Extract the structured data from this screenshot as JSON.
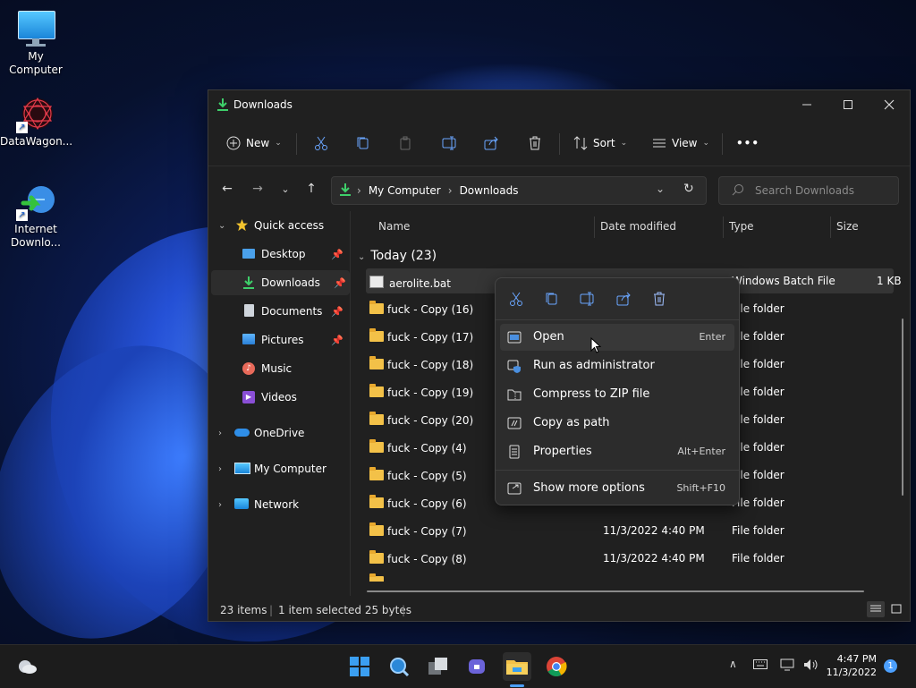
{
  "desktop": {
    "icons": [
      {
        "label": "My Computer"
      },
      {
        "label": "DataWagon..."
      },
      {
        "label": "Internet Downlo..."
      }
    ]
  },
  "window": {
    "title": "Downloads",
    "toolbar": {
      "new_label": "New",
      "sort_label": "Sort",
      "view_label": "View",
      "more_label": "•••"
    },
    "address": {
      "crumbs": [
        "My Computer",
        "Downloads"
      ]
    },
    "search": {
      "placeholder": "Search Downloads"
    }
  },
  "sidebar": {
    "quick_access": "Quick access",
    "items": [
      {
        "label": "Desktop",
        "pinned": true
      },
      {
        "label": "Downloads",
        "pinned": true,
        "selected": true
      },
      {
        "label": "Documents",
        "pinned": true
      },
      {
        "label": "Pictures",
        "pinned": true
      },
      {
        "label": "Music",
        "pinned": false
      },
      {
        "label": "Videos",
        "pinned": false
      }
    ],
    "onedrive": "OneDrive",
    "my_computer": "My Computer",
    "network": "Network"
  },
  "columns": {
    "name": "Name",
    "date": "Date modified",
    "type": "Type",
    "size": "Size"
  },
  "group": {
    "label": "Today (23)"
  },
  "files": [
    {
      "name": "aerolite.bat",
      "date": "",
      "type": "Windows Batch File",
      "size": "1 KB",
      "kind": "bat",
      "selected": true
    },
    {
      "name": "fuck - Copy (16)",
      "date": "",
      "type": "File folder",
      "size": "",
      "kind": "folder"
    },
    {
      "name": "fuck - Copy (17)",
      "date": "",
      "type": "File folder",
      "size": "",
      "kind": "folder"
    },
    {
      "name": "fuck - Copy (18)",
      "date": "",
      "type": "File folder",
      "size": "",
      "kind": "folder"
    },
    {
      "name": "fuck - Copy (19)",
      "date": "",
      "type": "File folder",
      "size": "",
      "kind": "folder"
    },
    {
      "name": "fuck - Copy (20)",
      "date": "",
      "type": "File folder",
      "size": "",
      "kind": "folder"
    },
    {
      "name": "fuck - Copy (4)",
      "date": "",
      "type": "File folder",
      "size": "",
      "kind": "folder"
    },
    {
      "name": "fuck - Copy (5)",
      "date": "",
      "type": "File folder",
      "size": "",
      "kind": "folder"
    },
    {
      "name": "fuck - Copy (6)",
      "date": "",
      "type": "File folder",
      "size": "",
      "kind": "folder"
    },
    {
      "name": "fuck - Copy (7)",
      "date": "11/3/2022 4:40 PM",
      "type": "File folder",
      "size": "",
      "kind": "folder"
    },
    {
      "name": "fuck - Copy (8)",
      "date": "11/3/2022 4:40 PM",
      "type": "File folder",
      "size": "",
      "kind": "folder"
    }
  ],
  "status": {
    "count": "23 items",
    "selected": "1 item selected  25 bytes"
  },
  "context_menu": {
    "items": [
      {
        "label": "Open",
        "key": "Enter",
        "icon": "open-icon"
      },
      {
        "label": "Run as administrator",
        "key": "",
        "icon": "shield-icon"
      },
      {
        "label": "Compress to ZIP file",
        "key": "",
        "icon": "zip-icon"
      },
      {
        "label": "Copy as path",
        "key": "",
        "icon": "path-icon"
      },
      {
        "label": "Properties",
        "key": "Alt+Enter",
        "icon": "properties-icon"
      },
      {
        "label": "Show more options",
        "key": "Shift+F10",
        "icon": "more-options-icon"
      }
    ]
  },
  "taskbar": {
    "time": "4:47 PM",
    "date": "11/3/2022",
    "notifications": "1"
  }
}
